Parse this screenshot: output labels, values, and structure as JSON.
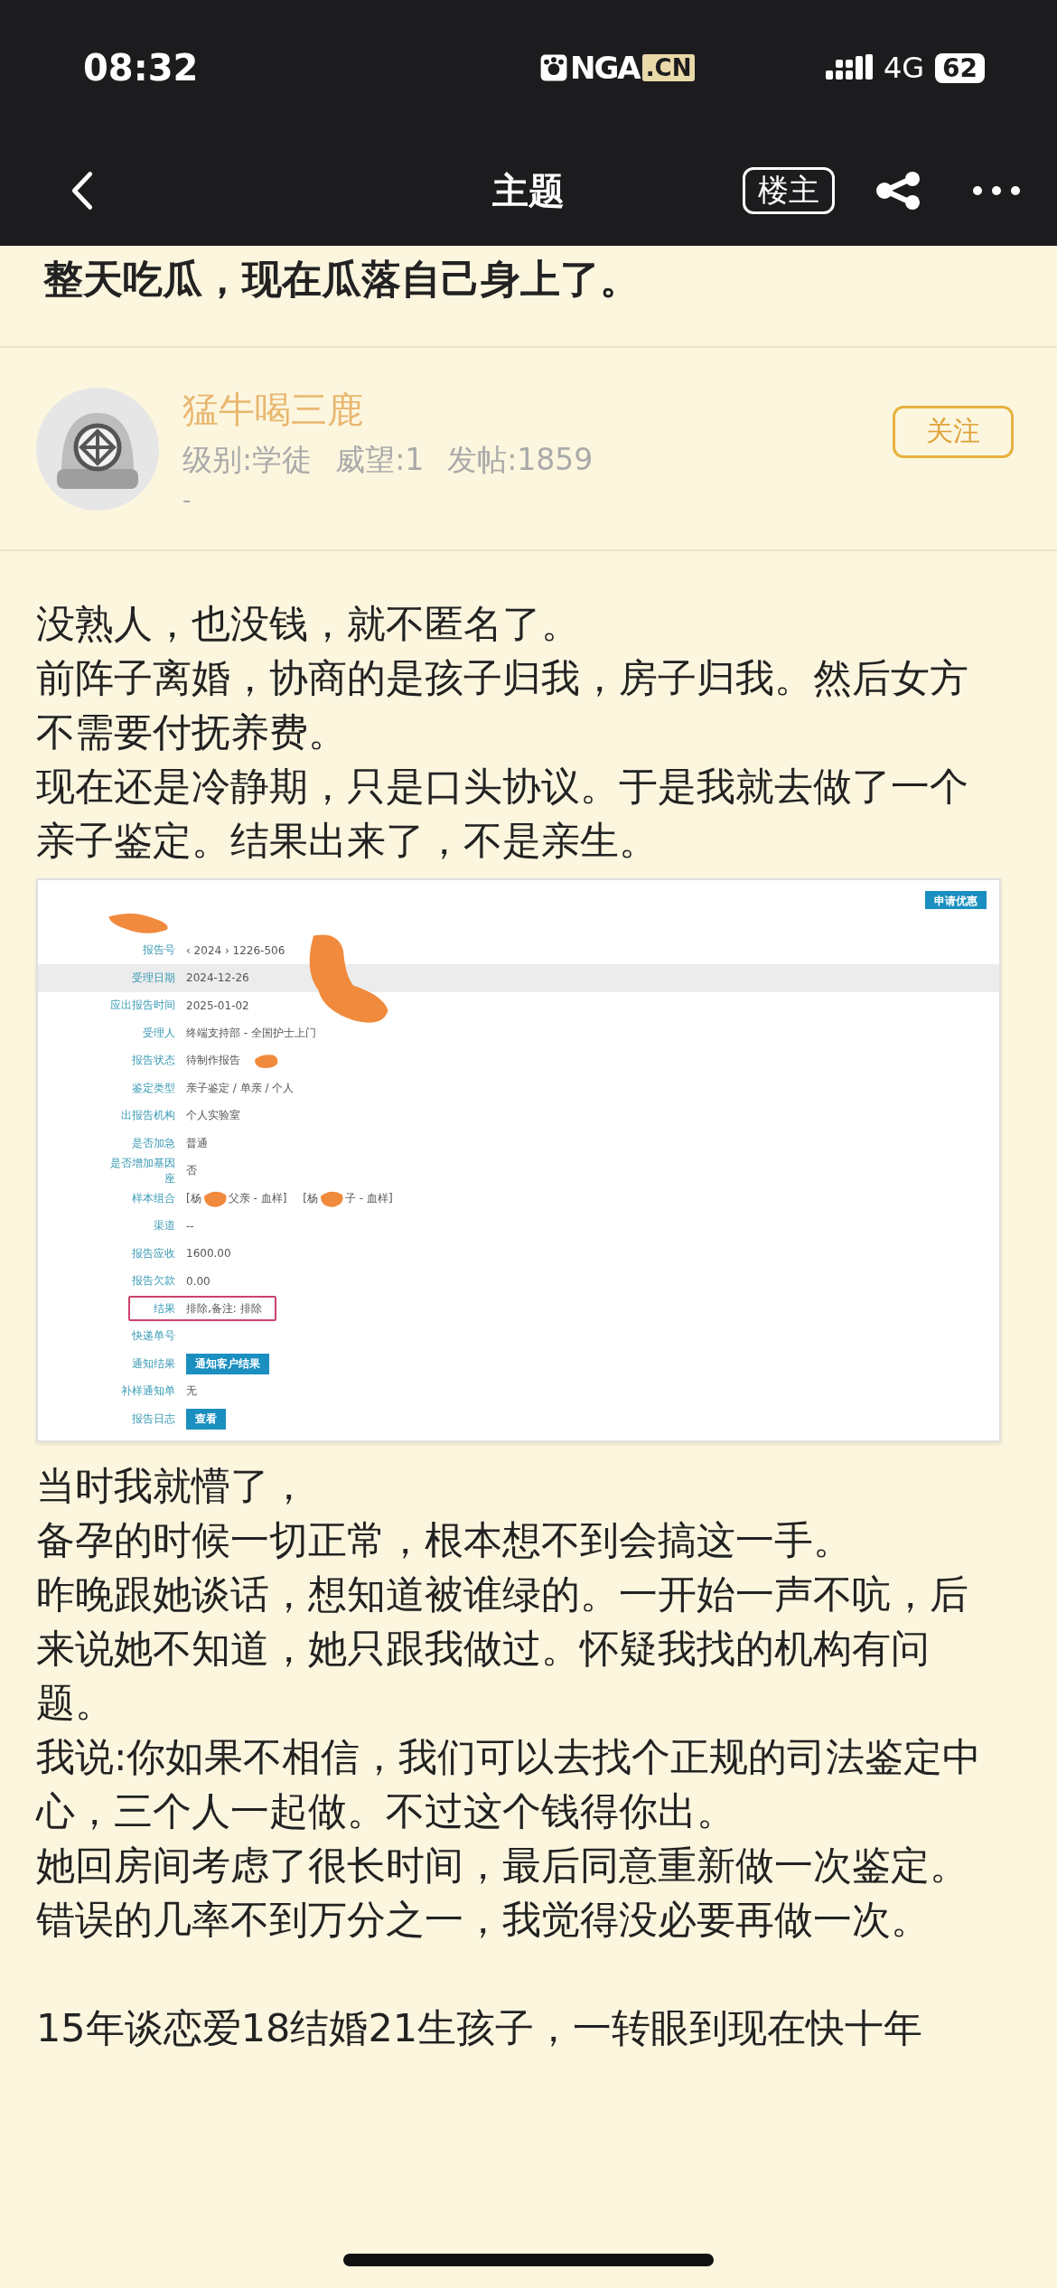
{
  "status_bar": {
    "time": "08:32",
    "logo_main": "NGA",
    "logo_tld": ".CN",
    "network": "4G",
    "battery": "62"
  },
  "nav": {
    "title": "主题",
    "author_only_button": "楼主"
  },
  "topic_title": "整天吃瓜，现在瓜落自己身上了。",
  "author": {
    "name": "猛牛喝三鹿",
    "level": "级别:学徒",
    "reputation": "威望:1",
    "posts": "发帖:1859",
    "signature": "-",
    "follow_button": "关注"
  },
  "paragraphs_before": [
    "没熟人，也没钱，就不匿名了。",
    "前阵子离婚，协商的是孩子归我，房子归我。然后女方不需要付抚养费。",
    "现在还是冷静期，只是口头协议。于是我就去做了一个亲子鉴定。结果出来了，不是亲生。"
  ],
  "report": {
    "action_button": "申请优惠",
    "rows": [
      {
        "kind": "redacted_label",
        "highlighted": false,
        "boxed": false
      },
      {
        "kind": "text_redacted_large",
        "label": "报告号",
        "value": "‹ 2024 › 1226-506",
        "highlighted": false,
        "boxed": false
      },
      {
        "kind": "text",
        "label": "受理日期",
        "value": "2024-12-26",
        "highlighted": true,
        "boxed": false
      },
      {
        "kind": "text",
        "label": "应出报告时间",
        "value": "2025-01-02",
        "highlighted": false,
        "boxed": false
      },
      {
        "kind": "text",
        "label": "受理人",
        "value": "终端支持部 - 全国护士上门",
        "highlighted": false,
        "boxed": false
      },
      {
        "kind": "text_redacted",
        "label": "报告状态",
        "value": "待制作报告",
        "highlighted": false,
        "boxed": false
      },
      {
        "kind": "text",
        "label": "鉴定类型",
        "value": "亲子鉴定 / 单亲 / 个人",
        "highlighted": false,
        "boxed": false
      },
      {
        "kind": "text",
        "label": "出报告机构",
        "value": "个人实验室",
        "highlighted": false,
        "boxed": false
      },
      {
        "kind": "text",
        "label": "是否加急",
        "value": "普通",
        "highlighted": false,
        "boxed": false
      },
      {
        "kind": "text",
        "label": "是否增加基因座",
        "value": "否",
        "highlighted": false,
        "boxed": false
      },
      {
        "kind": "parts",
        "label": "样本组合",
        "parts": [
          "[杨",
          "父亲 - 血样]",
          "[杨",
          "子 - 血样]"
        ],
        "highlighted": false,
        "boxed": false
      },
      {
        "kind": "text",
        "label": "渠道",
        "value": "--",
        "highlighted": false,
        "boxed": false
      },
      {
        "kind": "text",
        "label": "报告应收",
        "value": "1600.00",
        "highlighted": false,
        "boxed": false
      },
      {
        "kind": "text",
        "label": "报告欠款",
        "value": "0.00",
        "highlighted": false,
        "boxed": false
      },
      {
        "kind": "text",
        "label": "结果",
        "value": "排除,备注: 排除",
        "highlighted": false,
        "boxed": true
      },
      {
        "kind": "text",
        "label": "快递单号",
        "highlighted": false,
        "boxed": false
      },
      {
        "kind": "button",
        "label": "通知结果",
        "value": "通知客户结果",
        "highlighted": false,
        "boxed": false
      },
      {
        "kind": "text",
        "label": "补样通知单",
        "value": "无",
        "highlighted": false,
        "boxed": false
      },
      {
        "kind": "button",
        "label": "报告日志",
        "value": "查看",
        "highlighted": false,
        "boxed": false
      }
    ]
  },
  "paragraphs_after": [
    "当时我就懵了，",
    "备孕的时候一切正常，根本想不到会搞这一手。",
    "昨晚跟她谈话，想知道被谁绿的。一开始一声不吭，后来说她不知道，她只跟我做过。怀疑我找的机构有问题。",
    "我说:你如果不相信，我们可以去找个正规的司法鉴定中心，三个人一起做。不过这个钱得你出。",
    "她回房间考虑了很长时间，最后同意重新做一次鉴定。",
    "错误的几率不到万分之一，我觉得没必要再做一次。"
  ],
  "paragraphs_final": [
    "15年谈恋爱18结婚21生孩子，一转眼到现在快十年"
  ]
}
